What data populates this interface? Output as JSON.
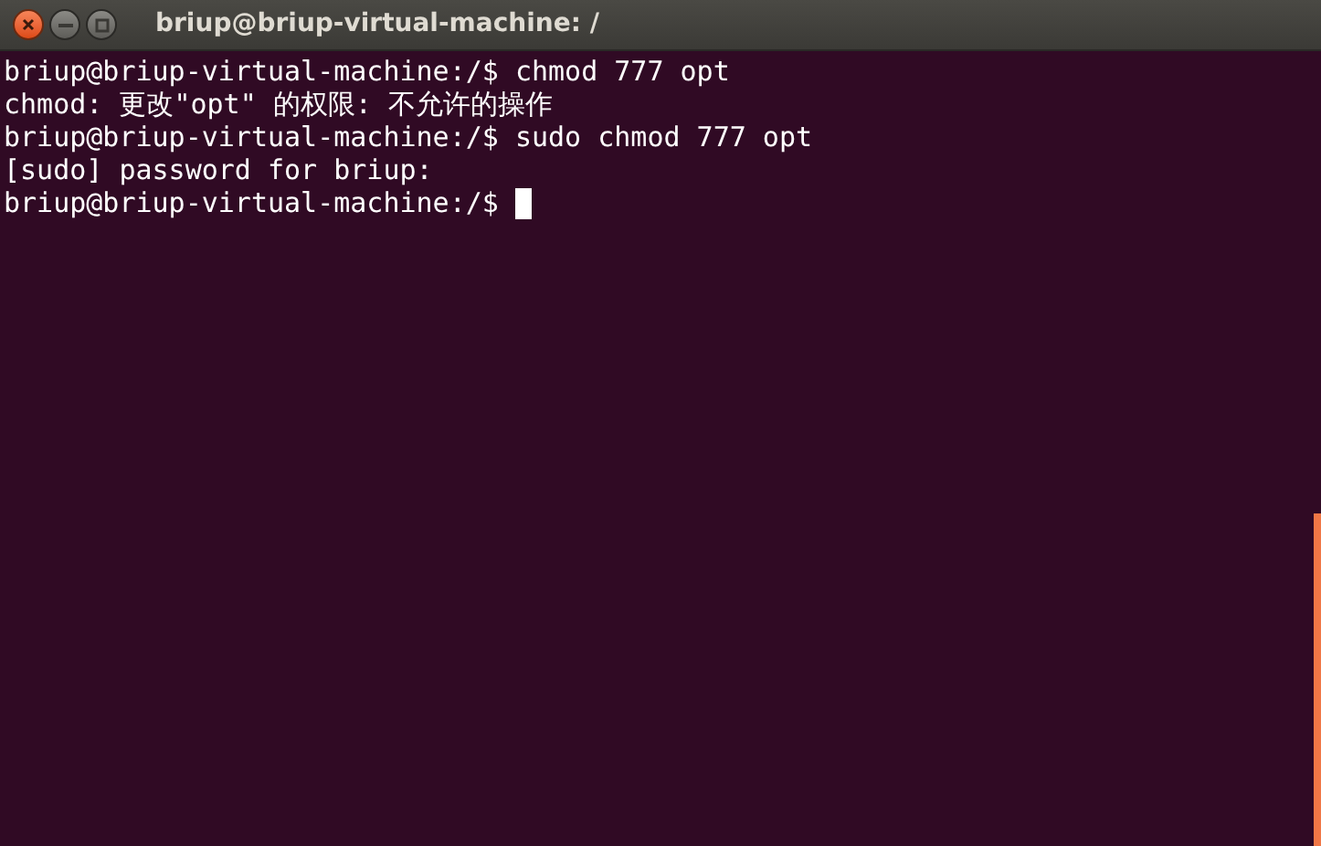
{
  "window": {
    "title": "briup@briup-virtual-machine: /"
  },
  "terminal": {
    "lines": [
      {
        "text": "briup@briup-virtual-machine:/$ chmod 777 opt"
      },
      {
        "text": "chmod: 更改\"opt\" 的权限: 不允许的操作"
      },
      {
        "text": "briup@briup-virtual-machine:/$ sudo chmod 777 opt"
      },
      {
        "text": "[sudo] password for briup:"
      },
      {
        "text": "briup@briup-virtual-machine:/$ "
      }
    ]
  }
}
